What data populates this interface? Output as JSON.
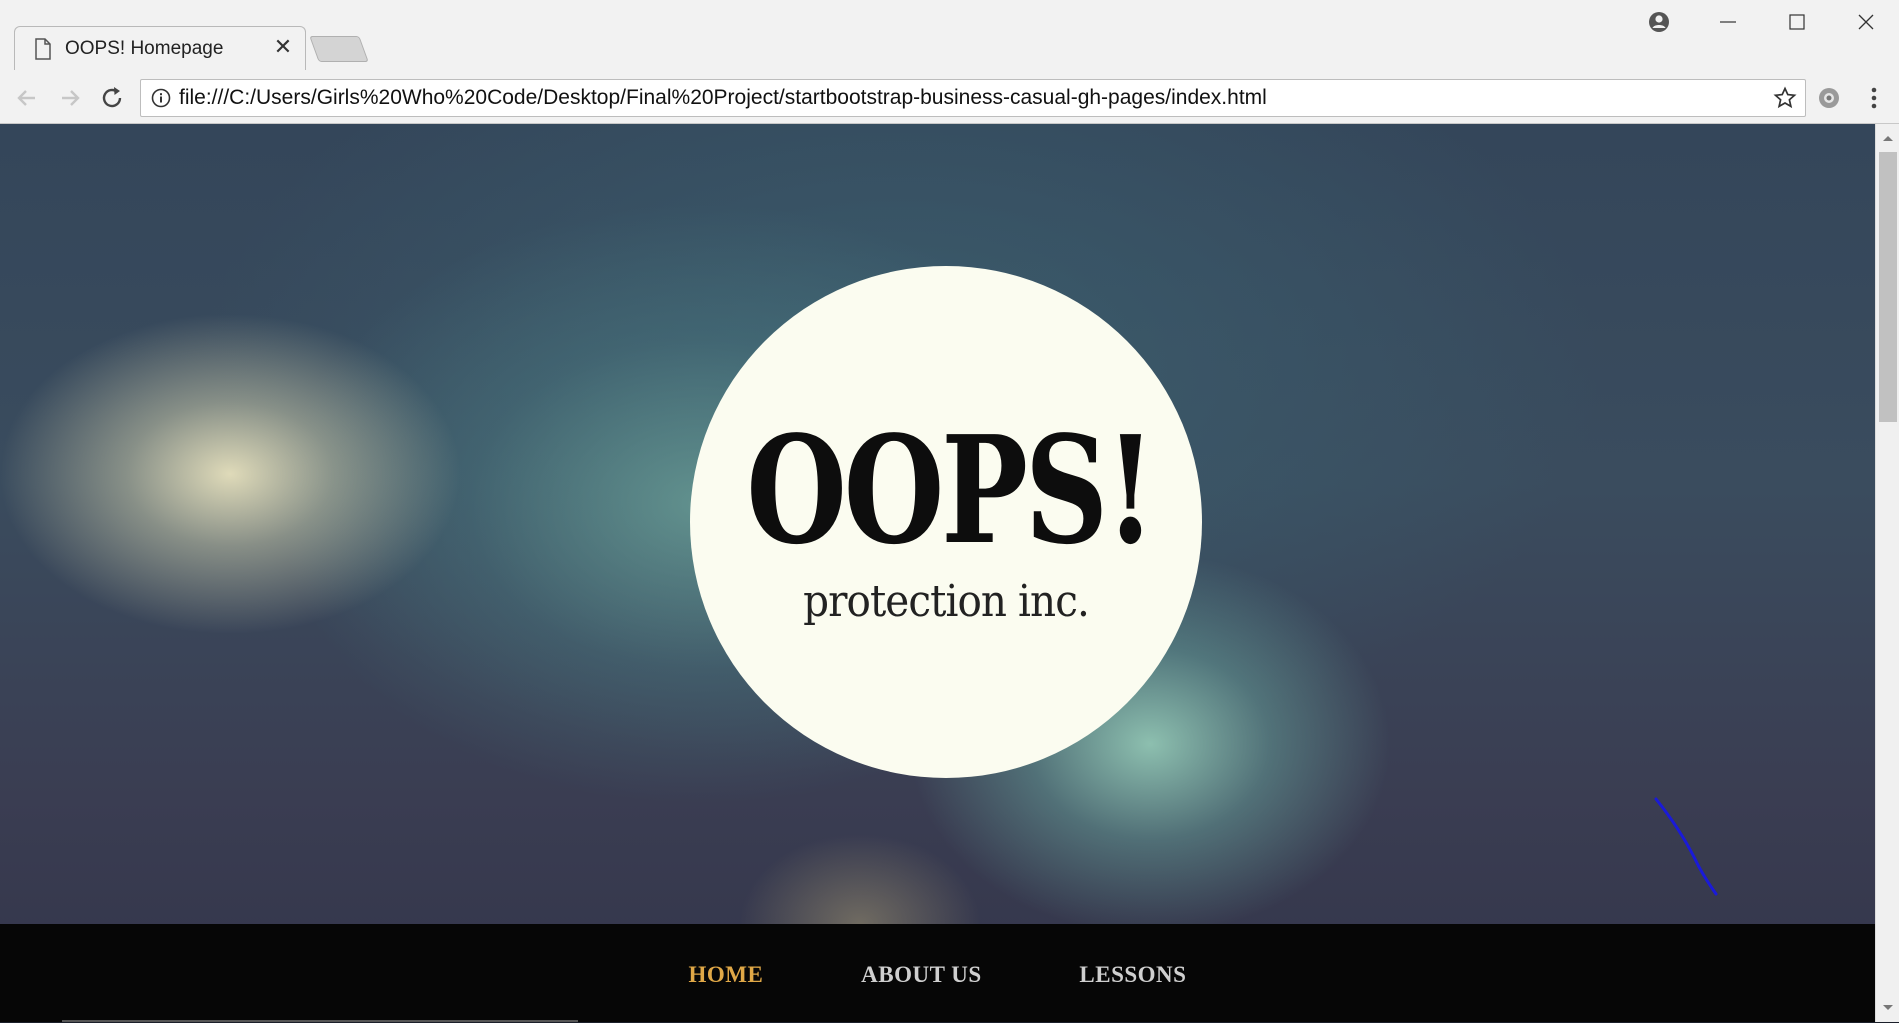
{
  "browser": {
    "tab": {
      "title": "OOPS! Homepage",
      "close_icon": "close-icon"
    },
    "address_bar": {
      "url": "file:///C:/Users/Girls%20Who%20Code/Desktop/Final%20Project/startbootstrap-business-casual-gh-pages/index.html"
    },
    "icons": [
      "back-arrow-icon",
      "forward-arrow-icon",
      "reload-icon",
      "info-icon",
      "star-icon",
      "extension-icon",
      "menu-dots-icon",
      "profile-icon",
      "minimize-icon",
      "maximize-icon",
      "close-window-icon"
    ]
  },
  "page": {
    "logo": {
      "main": "OOPS!",
      "sub": "protection inc."
    },
    "nav": [
      {
        "label": "Home",
        "active": true
      },
      {
        "label": "About Us",
        "active": false
      },
      {
        "label": "Lessons",
        "active": false
      }
    ]
  },
  "colors": {
    "nav_active": "#e0a847",
    "nav_inactive": "#cfcfcf",
    "nav_background": "#060606",
    "logo_circle": "#fbfcf0",
    "pen_stroke": "#1a1ad8"
  }
}
